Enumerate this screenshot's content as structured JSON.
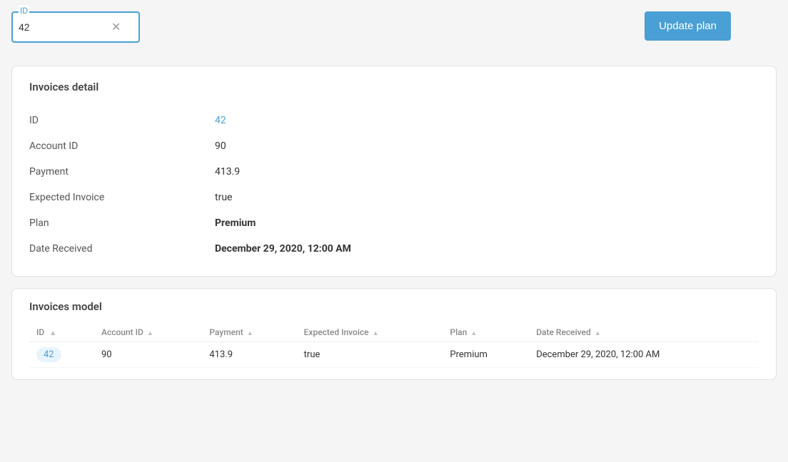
{
  "search": {
    "label": "ID",
    "value": "42",
    "placeholder": "ID"
  },
  "update_button": {
    "label": "Update plan"
  },
  "detail_section": {
    "title": "Invoices detail",
    "fields": [
      {
        "label": "ID",
        "value": "42",
        "type": "link"
      },
      {
        "label": "Account ID",
        "value": "90",
        "type": "text"
      },
      {
        "label": "Payment",
        "value": "413.9",
        "type": "text"
      },
      {
        "label": "Expected Invoice",
        "value": "true",
        "type": "text"
      },
      {
        "label": "Plan",
        "value": "Premium",
        "type": "bold"
      },
      {
        "label": "Date Received",
        "value": "December 29, 2020, 12:00 AM",
        "type": "bold"
      }
    ]
  },
  "model_section": {
    "title": "Invoices model",
    "columns": [
      {
        "label": "ID",
        "sortable": true
      },
      {
        "label": "Account ID",
        "sortable": true
      },
      {
        "label": "Payment",
        "sortable": true
      },
      {
        "label": "Expected Invoice",
        "sortable": true
      },
      {
        "label": "Plan",
        "sortable": true
      },
      {
        "label": "Date Received",
        "sortable": true
      }
    ],
    "rows": [
      {
        "id": "42",
        "account_id": "90",
        "payment": "413.9",
        "expected_invoice": "true",
        "plan": "Premium",
        "date_received": "December 29, 2020, 12:00 AM"
      }
    ]
  }
}
